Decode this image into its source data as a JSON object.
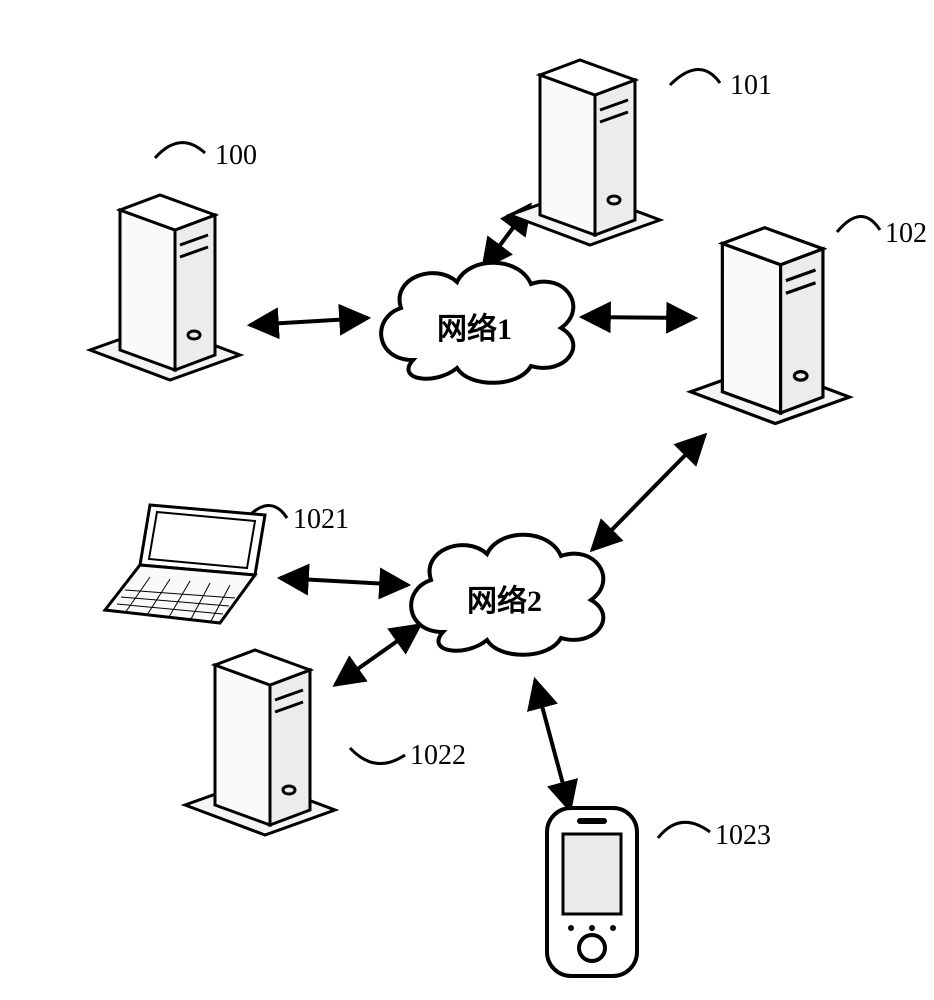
{
  "diagram": {
    "clouds": {
      "network1": {
        "label": "网络1"
      },
      "network2": {
        "label": "网络2"
      }
    },
    "nodes": {
      "n100": {
        "label": "100",
        "type": "tower"
      },
      "n101": {
        "label": "101",
        "type": "tower"
      },
      "n102": {
        "label": "102",
        "type": "tower"
      },
      "n1021": {
        "label": "1021",
        "type": "laptop"
      },
      "n1022": {
        "label": "1022",
        "type": "tower"
      },
      "n1023": {
        "label": "1023",
        "type": "phone"
      }
    },
    "edges": [
      {
        "from": "n100",
        "to": "network1"
      },
      {
        "from": "n101",
        "to": "network1"
      },
      {
        "from": "n102",
        "to": "network1"
      },
      {
        "from": "n102",
        "to": "network2"
      },
      {
        "from": "n1021",
        "to": "network2"
      },
      {
        "from": "n1022",
        "to": "network2"
      },
      {
        "from": "n1023",
        "to": "network2"
      }
    ]
  }
}
